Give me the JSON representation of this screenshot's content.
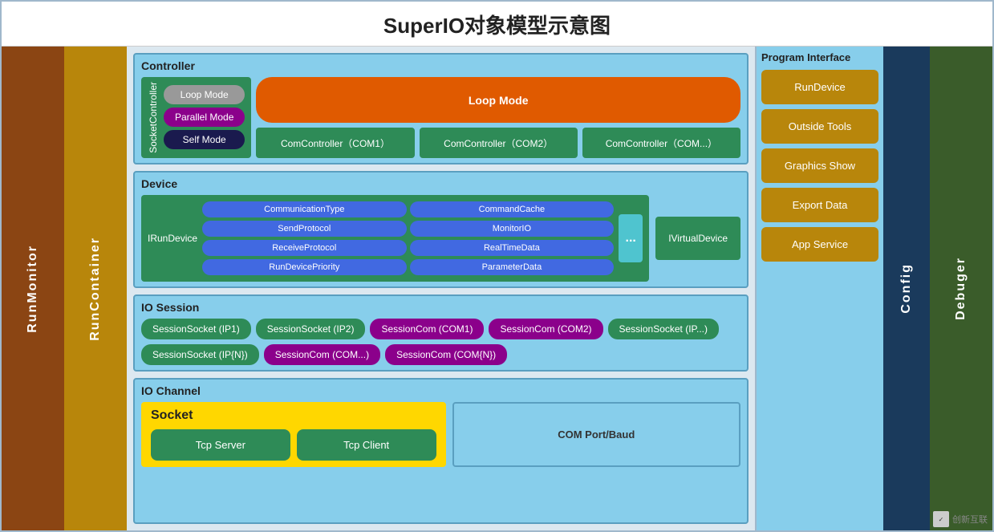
{
  "title": "SuperIO对象模型示意图",
  "left_bars": {
    "run_monitor": "RunMonitor",
    "run_container": "RunContainer"
  },
  "right_bars": {
    "config": "Config",
    "debuger": "Debuger"
  },
  "controller": {
    "section_title": "Controller",
    "socket_controller_label": "SocketController",
    "loop_mode_gray": "Loop Mode",
    "parallel_mode": "Parallel Mode",
    "self_mode": "Self Mode",
    "loop_mode_orange": "Loop Mode",
    "com_controllers": [
      "ComController（COM1）",
      "ComController（COM2）",
      "ComController（COM...）"
    ]
  },
  "device": {
    "section_title": "Device",
    "irun_label": "IRunDevice",
    "props": [
      "CommunicationType",
      "CommandCache",
      "SendProtocol",
      "MonitorIO",
      "ReceiveProtocol",
      "RealTimeData",
      "RunDevicePriority",
      "ParameterData"
    ],
    "dots": "...",
    "ivirtual": "IVirtualDevice"
  },
  "io_session": {
    "section_title": "IO Session",
    "session_sockets": [
      "SessionSocket (IP1)",
      "SessionSocket (IP2)",
      "SessionSocket (IP...)",
      "SessionSocket (IP{N})"
    ],
    "session_coms": [
      "SessionCom (COM1)",
      "SessionCom (COM2)",
      "SessionCom (COM...)",
      "SessionCom (COM{N})"
    ]
  },
  "io_channel": {
    "section_title": "IO Channel",
    "socket_title": "Socket",
    "tcp_server": "Tcp Server",
    "tcp_client": "Tcp Client",
    "com_port": "COM Port/Baud"
  },
  "program_interface": {
    "title": "Program Interface",
    "buttons": [
      "RunDevice",
      "Outside Tools",
      "Graphics Show",
      "Export Data",
      "App Service"
    ]
  },
  "watermark": "创新互联"
}
